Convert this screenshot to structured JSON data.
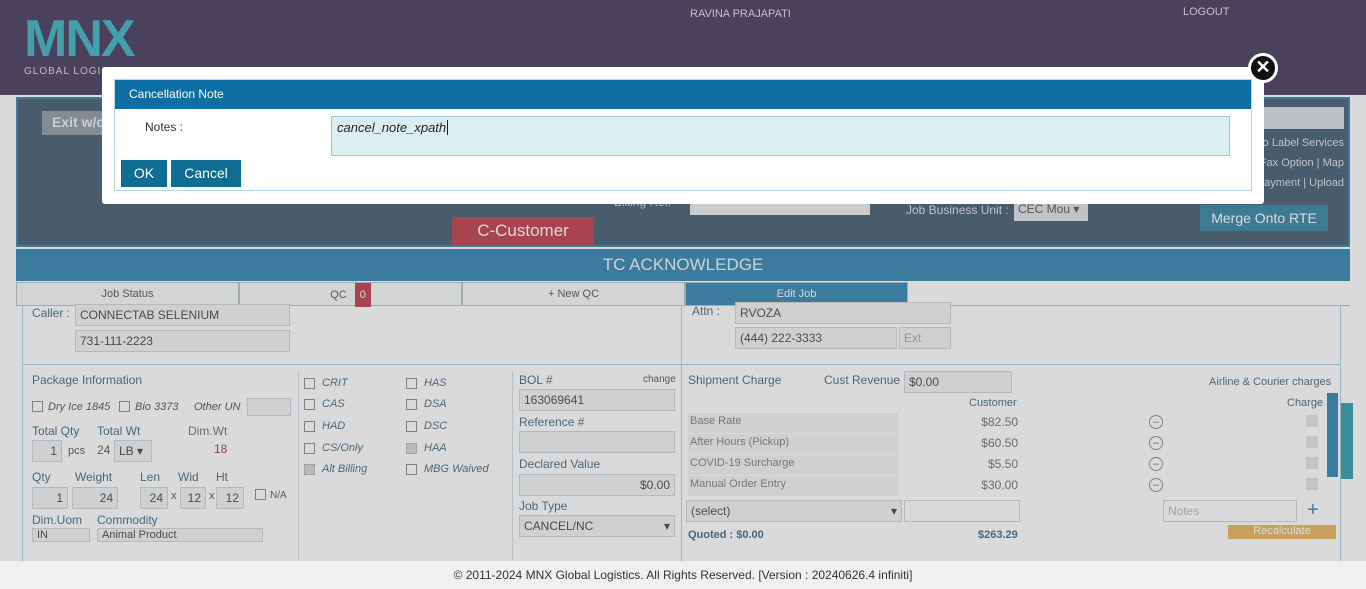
{
  "header": {
    "logo_text": "MNX",
    "logo_sub": "GLOBAL LOGISTICS",
    "username": "RAVINA PRAJAPATI",
    "logout": "LOGOUT"
  },
  "job_panel": {
    "exit_label": "Exit w/o",
    "customer_type": "C-Customer",
    "merge_button": "Merge Onto RTE",
    "billing_label": "Billing Ref.",
    "job_business_unit_label": "Job Business Unit :",
    "job_business_unit_value": "CEC Mou",
    "side_links": [
      "o Label Services",
      "Fax Option | Map",
      "ayment | Upload"
    ]
  },
  "tc_banner": "TC ACKNOWLEDGE",
  "tabs": [
    {
      "label": "Job Status"
    },
    {
      "label": "QC",
      "badge": "0"
    },
    {
      "label": "+ New QC"
    },
    {
      "label": "Edit Job"
    }
  ],
  "caller": {
    "label": "Caller :",
    "name": "CONNECTAB SELENIUM",
    "phone": "731-111-2223"
  },
  "attn": {
    "label": "Attn :",
    "name": "RVOZA",
    "phone": "(444) 222-3333",
    "ext_placeholder": "Ext"
  },
  "package": {
    "title": "Package Information",
    "dry_ice": "Dry Ice 1845",
    "bio": "Bio 3373",
    "other_un": "Other UN",
    "total_qty_label": "Total Qty",
    "total_qty": "1",
    "pcs": "pcs",
    "total_wt_label": "Total Wt",
    "total_wt": "24",
    "wt_unit": "LB",
    "dim_wt_label": "Dim.Wt",
    "dim_wt": "18",
    "qty_label": "Qty",
    "qty": "1",
    "weight_label": "Weight",
    "weight": "24",
    "len_label": "Len",
    "len": "24",
    "wid_label": "Wid",
    "wid": "12",
    "ht_label": "Ht",
    "ht": "12",
    "x": "x",
    "na": "N/A",
    "dim_uom_label": "Dim.Uom",
    "dim_uom": "IN",
    "commodity_label": "Commodity",
    "commodity": "Animal Product"
  },
  "flags": {
    "left": [
      "CRIT",
      "CAS",
      "HAD",
      "CS/Only",
      "Alt Billing"
    ],
    "right": [
      "HAS",
      "DSA",
      "DSC",
      "HAA",
      "MBG Waived"
    ]
  },
  "bol": {
    "label": "BOL #",
    "change": "change",
    "value": "163069641",
    "reference_label": "Reference #",
    "declared_label": "Declared Value",
    "declared_value": "$0.00",
    "job_type_label": "Job Type",
    "job_type": "CANCEL/NC"
  },
  "shipment": {
    "title": "Shipment Charge",
    "cust_revenue_label": "Cust Revenue",
    "cust_revenue": "$0.00",
    "airline_link": "Airline & Courier charges",
    "customer_col": "Customer",
    "charge_col": "Charge",
    "rows": [
      {
        "name": "Base Rate",
        "value": "$82.50"
      },
      {
        "name": "After Hours (Pickup)",
        "value": "$60.50"
      },
      {
        "name": "COVID-19 Surcharge",
        "value": "$5.50"
      },
      {
        "name": "Manual Order Entry",
        "value": "$30.00"
      }
    ],
    "select_placeholder": "(select)",
    "notes_placeholder": "Notes",
    "quoted_label": "Quoted : $0.00",
    "total": "$263.29",
    "recalc": "Recalculate"
  },
  "footer": "© 2011-2024 MNX Global Logistics. All Rights Reserved. [Version : 20240626.4 infiniti]",
  "dialog": {
    "title": "Cancellation Note",
    "notes_label": "Notes :",
    "notes_value": "cancel_note_xpath",
    "ok": "OK",
    "cancel": "Cancel"
  }
}
